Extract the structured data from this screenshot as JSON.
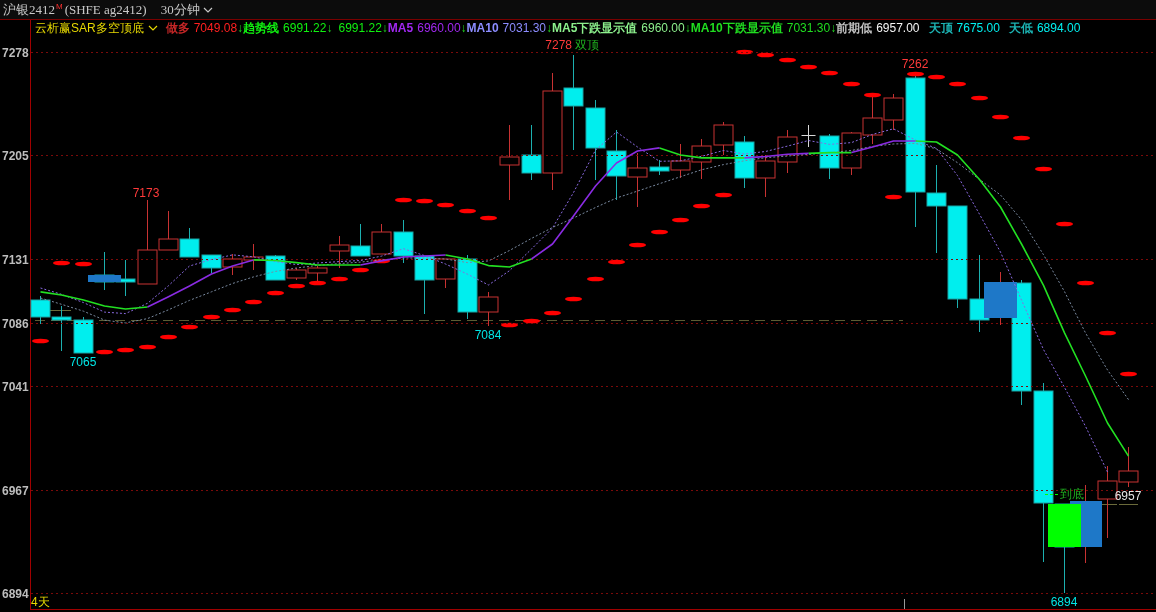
{
  "header": {
    "symbol": "沪银2412$^{M}$",
    "contract": "(SHFE ag2412)",
    "period": "30分钟"
  },
  "indicator_bar": {
    "name": "云析赢SAR多空顶底",
    "runs": [
      {
        "kind": "label",
        "text": "做多",
        "color": "#c42626"
      },
      {
        "kind": "value",
        "text": "7049.08",
        "color": "#ff2020"
      },
      {
        "kind": "arrow",
        "text": "↓"
      },
      {
        "kind": "label",
        "text": "趋势线",
        "color": "#10f010"
      },
      {
        "kind": "value",
        "text": "6991.22",
        "color": "#10f010"
      },
      {
        "kind": "arrow",
        "text": "↓"
      },
      {
        "kind": "value",
        "text": "6991.22",
        "color": "#10f010"
      },
      {
        "kind": "arrow",
        "text": "↓"
      },
      {
        "kind": "label",
        "text": "MA5",
        "color": "#a028f0"
      },
      {
        "kind": "value",
        "text": "6960.00",
        "color": "#a028f0"
      },
      {
        "kind": "arrow",
        "text": "↓"
      },
      {
        "kind": "label",
        "text": "MA10",
        "color": "#8c8cff"
      },
      {
        "kind": "value",
        "text": "7031.30",
        "color": "#8c8cff"
      },
      {
        "kind": "arrow",
        "text": "↓"
      },
      {
        "kind": "label",
        "text": "MA5下跌显示值",
        "color": "#8cf08c"
      },
      {
        "kind": "value",
        "text": "6960.00",
        "color": "#8cf08c"
      },
      {
        "kind": "arrow",
        "text": "↓"
      },
      {
        "kind": "label",
        "text": "MA10下跌显示值",
        "color": "#20dc20"
      },
      {
        "kind": "value",
        "text": "7031.30",
        "color": "#20dc20"
      },
      {
        "kind": "arrow",
        "text": "↓"
      },
      {
        "kind": "label",
        "text": "前期低",
        "color": "#c0c0c0"
      },
      {
        "kind": "value",
        "text": "6957.00",
        "color": "#f4f4f4"
      },
      {
        "kind": "label",
        "text": "天顶",
        "color": "#1cb4b4"
      },
      {
        "kind": "value",
        "text": "7675.00",
        "color": "#00f0f0"
      },
      {
        "kind": "label",
        "text": "天低",
        "color": "#1cb4b4"
      },
      {
        "kind": "value",
        "text": "6894.00",
        "color": "#00f0f0"
      }
    ]
  },
  "chart": {
    "chart_data": {
      "type": "line",
      "ylim": [
        6894,
        7278
      ],
      "yticks": [
        7278,
        7205,
        7131,
        7086,
        7041,
        6967,
        6894
      ],
      "grid": true,
      "series": [
        {
          "color": "#22e022",
          "line_style": "solid",
          "values": [
            7107.7,
            7105.5,
            7102.0,
            7097.7,
            7095.6,
            7097.0,
            null,
            null,
            null,
            null,
            7130.4,
            7130.0,
            7128.5,
            7126.8,
            7126.8,
            7126.8,
            null,
            null,
            null,
            7133.9,
            7131.1,
            7126.4,
            7125.4,
            7131.1,
            null,
            null,
            null,
            null,
            null,
            7209.9,
            7204.9,
            7202.8,
            7202.8,
            7202.8,
            null,
            null,
            7206.0,
            7206.6,
            7206.6,
            null,
            null,
            7214.8,
            7214.1,
            7204.9,
            7187.5,
            7168.0,
            7141.7,
            7112.3,
            7078.6,
            7048.0,
            7014.7,
            6991.2
          ]
        },
        {
          "color": "#8a2be2",
          "line_style": "solid",
          "values": [
            null,
            null,
            null,
            null,
            null,
            7097.0,
            7104.3,
            7111.9,
            7120.4,
            7126.1,
            7130.4,
            null,
            null,
            null,
            null,
            7126.8,
            7129.7,
            7132.5,
            7133.2,
            7133.9,
            null,
            null,
            null,
            7131.1,
            7141.7,
            7161.6,
            7182.9,
            7199.2,
            7207.7,
            7209.9,
            null,
            null,
            null,
            7202.8,
            7203.8,
            7205.4,
            7206.0,
            null,
            7206.6,
            7210.6,
            7214.8,
            7214.8,
            null,
            null,
            null,
            null,
            null,
            null,
            null,
            null,
            null,
            null
          ]
        },
        {
          "color": "#8a6ae0",
          "line_style": "dashed",
          "values": [
            7110.5,
            7106.0,
            7100.1,
            7093.4,
            7092.3,
            7099.6,
            7112.1,
            7126.1,
            7130.7,
            7134.0,
            7132.6,
            7129.3,
            7127.1,
            7128.2,
            7129.2,
            7130.0,
            7133.1,
            7138.4,
            7133.5,
            7127.5,
            7120.3,
            7112.6,
            7122.8,
            7138.2,
            7153.1,
            7178.2,
            7208.4,
            7221.2,
            7210.6,
            7200.4,
            7200.8,
            7204.0,
            7208.1,
            7205.6,
            7207.4,
            7211.2,
            7215.2,
            7212.4,
            7213.7,
            7219.5,
            7223.5,
            7215.5,
            7209.6,
            7190.3,
            7162.9,
            7136.0,
            7102.0,
            7066.8,
            7039.9,
            7012.3,
            6979.9,
            null
          ]
        },
        {
          "color": "#7a8aa0",
          "line_style": "dashed",
          "values": [
            7103.4,
            7098.9,
            7094.0,
            7087.7,
            7085.7,
            7088.8,
            7095.0,
            7101.7,
            7107.8,
            7113.7,
            7118.4,
            7122.3,
            7124.7,
            7126.5,
            7127.8,
            7128.9,
            7130.4,
            7131.8,
            7131.8,
            7131.1,
            7128.5,
            7129.7,
            7137.1,
            7145.7,
            7153.4,
            7160.2,
            7167.6,
            7174.4,
            7179.3,
            7184.5,
            7189.5,
            7194.4,
            7198.1,
            7200.8,
            7203.0,
            7204.2,
            7205.3,
            7206.5,
            7208.1,
            7211.0,
            7212.7,
            7213.1,
            7209.2,
            7199.4,
            7187.6,
            7176.5,
            7159.0,
            7134.1,
            7107.9,
            7078.6,
            7052.3,
            7031.3
          ]
        }
      ]
    },
    "annotations": [
      {
        "kind": "high",
        "text": "7278"
      },
      {
        "kind": "signal",
        "text": "双顶"
      },
      {
        "kind": "high",
        "text": "7173"
      },
      {
        "kind": "low",
        "text": "7065"
      },
      {
        "kind": "low",
        "text": "7084"
      },
      {
        "kind": "high",
        "text": "7262"
      },
      {
        "kind": "signal",
        "text": "到底"
      },
      {
        "kind": "price",
        "text": "6957"
      },
      {
        "kind": "low",
        "text": "6894"
      }
    ],
    "period_count": "4天"
  }
}
